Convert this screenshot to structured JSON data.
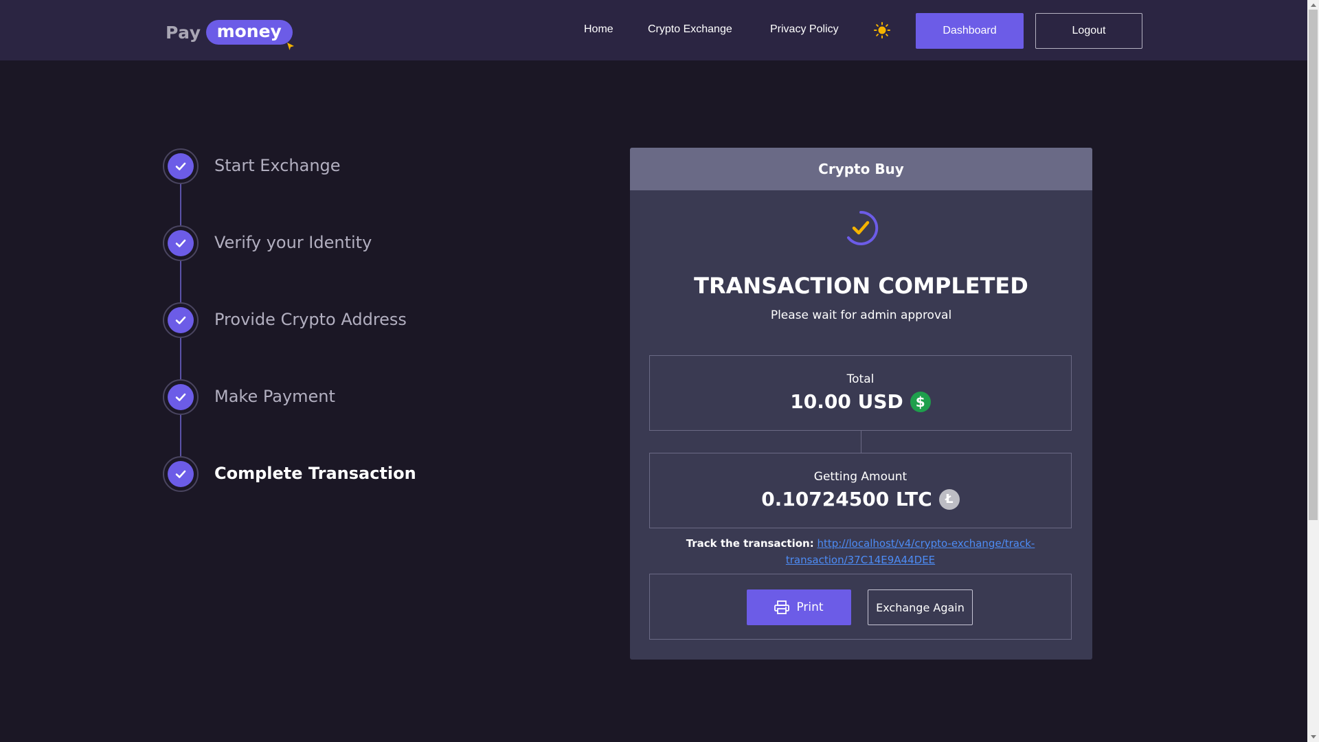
{
  "header": {
    "logo_pay": "Pay",
    "logo_money": "money",
    "nav": [
      "Home",
      "Crypto Exchange",
      "Privacy Policy"
    ],
    "theme_icon": "sun-icon",
    "dashboard_label": "Dashboard",
    "logout_label": "Logout"
  },
  "steps": [
    {
      "label": "Start Exchange",
      "done": true
    },
    {
      "label": "Verify your Identity",
      "done": true
    },
    {
      "label": "Provide Crypto Address",
      "done": true
    },
    {
      "label": "Make Payment",
      "done": true
    },
    {
      "label": "Complete Transaction",
      "done": true,
      "active": true
    }
  ],
  "card": {
    "title": "Crypto Buy",
    "status_title": "TRANSACTION COMPLETED",
    "status_sub": "Please wait for admin approval",
    "total_label": "Total",
    "total_value": "10.00 USD",
    "total_icon": "dollar-coin-icon",
    "getting_label": "Getting Amount",
    "getting_value": "0.10724500 LTC",
    "getting_icon": "litecoin-icon",
    "track_label": "Track the transaction:",
    "track_link_line1": "http://localhost/v4/crypto-exchange/track-",
    "track_link_line2": "transaction/37C14E9A44DEE",
    "print_label": "Print",
    "exchange_again_label": "Exchange Again"
  },
  "colors": {
    "accent": "#6c5ce7",
    "background": "#1b1725",
    "header": "#2b2542",
    "card": "#3a3a52",
    "link": "#4d8cf5"
  }
}
